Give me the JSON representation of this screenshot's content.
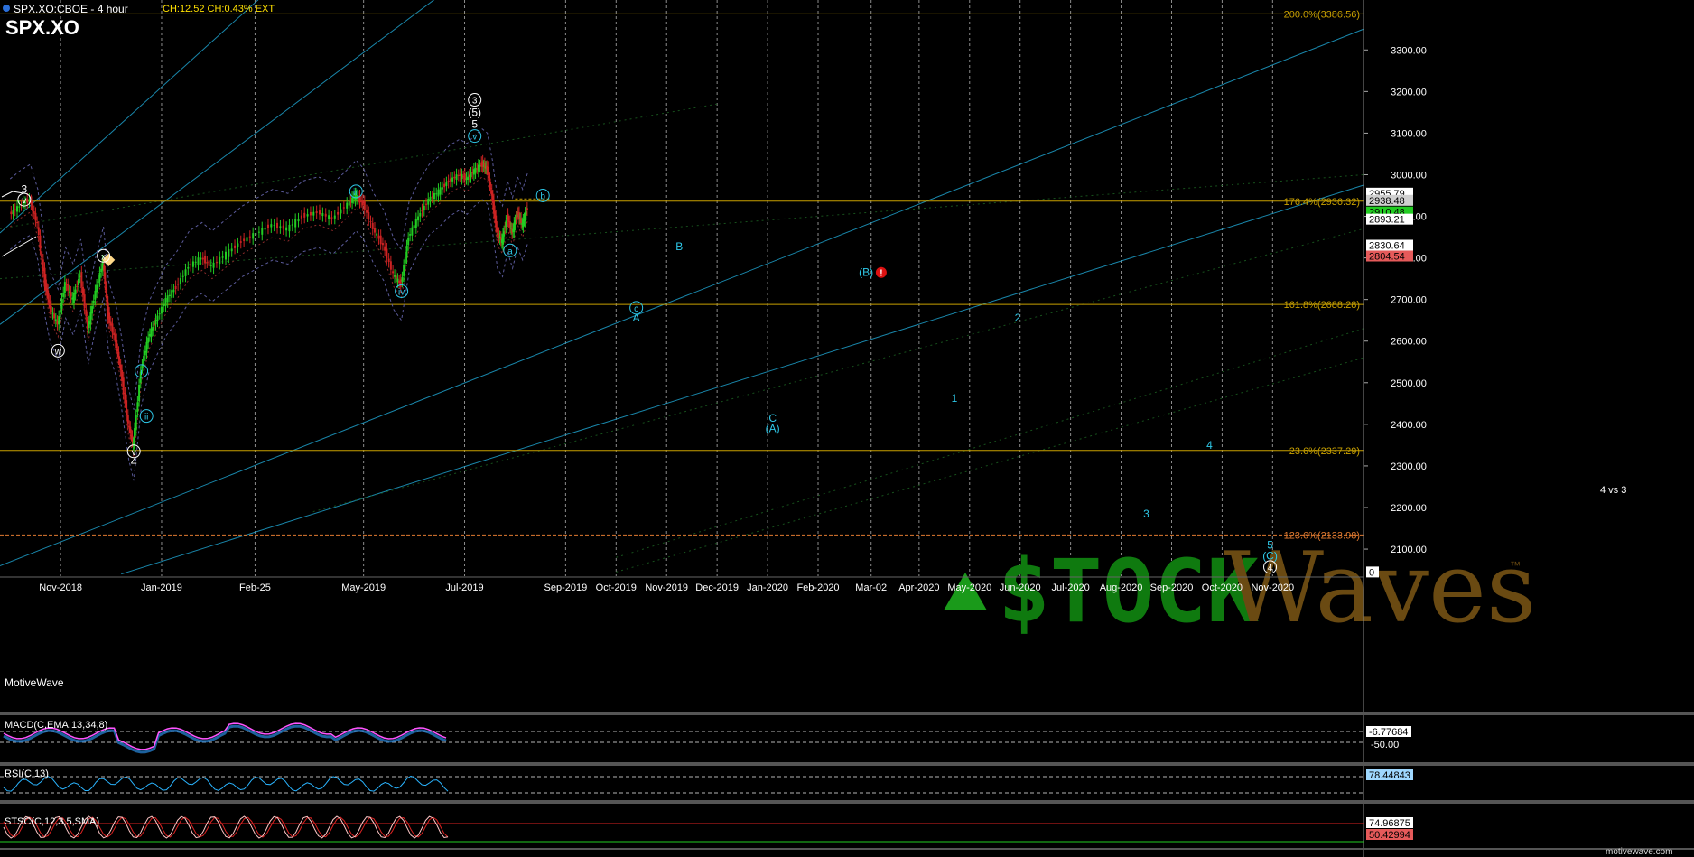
{
  "header": {
    "symbol_line": "SPX.XO:CBOE - 4 hour",
    "stats": "CH:12.52 CH:0.43% EXT",
    "big_symbol": "SPX.XO",
    "watermark": "MotiveWave",
    "footer_brand": "motivewave.com"
  },
  "colors": {
    "background": "#000000",
    "grid": "#ffffff",
    "fib": "#c8a000",
    "fib_extension": "#e07a30",
    "channel": "#1e9ec8",
    "wave_labels": "#2ec8e8",
    "up_candle": "#22cc22",
    "down_candle": "#cc2222",
    "macd_line": "#ff55ff",
    "rsi_line": "#2ab4ff",
    "logo_green": "#1a9a1a",
    "logo_brown": "#8a5a1a"
  },
  "chart_data": {
    "type": "line",
    "title": "SPX.XO",
    "ylim": [
      2035,
      3420
    ],
    "y_ticks": [
      2100,
      2200,
      2300,
      2400,
      2500,
      2600,
      2700,
      2800,
      2900,
      3000,
      3100,
      3200,
      3300
    ],
    "y_tick_labels": [
      "2100.00",
      "2200.00",
      "2300.00",
      "2400.00",
      "2500.00",
      "2600.00",
      "2700.00",
      "2800.00",
      "2900.00",
      "3000.00",
      "3100.00",
      "3200.00",
      "3300.00"
    ],
    "x_labels": [
      "Nov-2018",
      "Jan-2019",
      "Feb-25",
      "May-2019",
      "Jul-2019",
      "Sep-2019",
      "Oct-2019",
      "Nov-2019",
      "Dec-2019",
      "Jan-2020",
      "Feb-2020",
      "Mar-02",
      "Apr-2020",
      "May-2020",
      "Jun-2020",
      "Jul-2020",
      "Aug-2020",
      "Sep-2020",
      "Oct-2020",
      "Nov-2020"
    ],
    "x_label_months": [
      1.0,
      3.0,
      4.85,
      7.0,
      9.0,
      11.0,
      12.0,
      13.0,
      14.0,
      15.0,
      16.0,
      17.05,
      18.0,
      19.0,
      20.0,
      21.0,
      22.0,
      23.0,
      24.0,
      25.0
    ],
    "price_path": [
      [
        0.0,
        2905
      ],
      [
        0.2,
        2925
      ],
      [
        0.4,
        2940
      ],
      [
        0.55,
        2880
      ],
      [
        0.7,
        2740
      ],
      [
        0.8,
        2680
      ],
      [
        0.95,
        2640
      ],
      [
        1.1,
        2740
      ],
      [
        1.25,
        2700
      ],
      [
        1.4,
        2760
      ],
      [
        1.55,
        2630
      ],
      [
        1.7,
        2720
      ],
      [
        1.85,
        2790
      ],
      [
        1.95,
        2660
      ],
      [
        2.1,
        2600
      ],
      [
        2.2,
        2530
      ],
      [
        2.35,
        2400
      ],
      [
        2.45,
        2350
      ],
      [
        2.6,
        2530
      ],
      [
        2.75,
        2610
      ],
      [
        2.9,
        2650
      ],
      [
        3.1,
        2700
      ],
      [
        3.3,
        2730
      ],
      [
        3.55,
        2780
      ],
      [
        3.8,
        2800
      ],
      [
        4.0,
        2780
      ],
      [
        4.3,
        2810
      ],
      [
        4.6,
        2840
      ],
      [
        4.9,
        2860
      ],
      [
        5.2,
        2880
      ],
      [
        5.5,
        2870
      ],
      [
        5.8,
        2900
      ],
      [
        6.1,
        2910
      ],
      [
        6.4,
        2895
      ],
      [
        6.7,
        2930
      ],
      [
        6.85,
        2950
      ],
      [
        7.0,
        2930
      ],
      [
        7.2,
        2870
      ],
      [
        7.4,
        2830
      ],
      [
        7.6,
        2760
      ],
      [
        7.75,
        2735
      ],
      [
        7.9,
        2850
      ],
      [
        8.1,
        2900
      ],
      [
        8.3,
        2940
      ],
      [
        8.5,
        2960
      ],
      [
        8.7,
        2985
      ],
      [
        8.9,
        3000
      ],
      [
        9.05,
        2990
      ],
      [
        9.2,
        3010
      ],
      [
        9.35,
        3025
      ],
      [
        9.45,
        3015
      ],
      [
        9.55,
        2950
      ],
      [
        9.65,
        2860
      ],
      [
        9.75,
        2840
      ],
      [
        9.85,
        2900
      ],
      [
        9.95,
        2860
      ],
      [
        10.05,
        2910
      ],
      [
        10.15,
        2880
      ],
      [
        10.25,
        2920
      ]
    ],
    "levels": [
      {
        "label": "200.0%(3386.56)",
        "value": 3386.56,
        "style": "fib"
      },
      {
        "label": "176.4%(2936.32)",
        "value": 2936.32,
        "style": "fib"
      },
      {
        "label": "161.8%(2688.28)",
        "value": 2688.28,
        "style": "fib"
      },
      {
        "label": "23.6%(2337.29)",
        "value": 2337.29,
        "style": "fib"
      },
      {
        "label": "123.6%(2133.98)",
        "value": 2133.98,
        "style": "ext"
      }
    ],
    "price_tags": [
      {
        "label": "2955.79",
        "value": 2955.79,
        "bg": "#ffffff",
        "fg": "#000000"
      },
      {
        "label": "2938.48",
        "value": 2938.48,
        "bg": "#cfcfcf",
        "fg": "#000000"
      },
      {
        "label": "2910.48",
        "value": 2910.48,
        "bg": "#22cc22",
        "fg": "#000000"
      },
      {
        "label": "2893.21",
        "value": 2893.21,
        "bg": "#ffffff",
        "fg": "#000000"
      },
      {
        "label": "2830.64",
        "value": 2830.64,
        "bg": "#ffffff",
        "fg": "#000000"
      },
      {
        "label": "2804.54",
        "value": 2804.54,
        "bg": "#e55a5a",
        "fg": "#000000"
      },
      {
        "label": "0",
        "value": 2045,
        "bg": "#ffffff",
        "fg": "#000000"
      }
    ],
    "wave_labels": [
      {
        "text": "3",
        "m": 0.28,
        "v": 2965,
        "color": "#ffffff"
      },
      {
        "text": "v",
        "m": 0.28,
        "v": 2940,
        "color": "#ffffff",
        "circle": true
      },
      {
        "text": "x",
        "m": 1.85,
        "v": 2805,
        "color": "#ffffff",
        "circle": true
      },
      {
        "text": "w",
        "m": 0.95,
        "v": 2577,
        "color": "#ffffff",
        "circle": true
      },
      {
        "text": "i",
        "m": 2.6,
        "v": 2528,
        "color": "#2ec8e8",
        "circle": true
      },
      {
        "text": "ii",
        "m": 2.7,
        "v": 2420,
        "color": "#2ec8e8",
        "circle": true
      },
      {
        "text": "v",
        "m": 2.45,
        "v": 2335,
        "color": "#ffffff",
        "circle": true
      },
      {
        "text": "4",
        "m": 2.45,
        "v": 2310,
        "color": "#ffffff"
      },
      {
        "text": "iii",
        "m": 6.85,
        "v": 2960,
        "color": "#2ec8e8",
        "circle": true
      },
      {
        "text": "iv",
        "m": 7.75,
        "v": 2720,
        "color": "#2ec8e8",
        "circle": true
      },
      {
        "text": "3",
        "m": 9.2,
        "v": 3180,
        "color": "#ffffff",
        "circle": true
      },
      {
        "text": "(5)",
        "m": 9.2,
        "v": 3150,
        "color": "#ffffff"
      },
      {
        "text": "5",
        "m": 9.2,
        "v": 3122,
        "color": "#ffffff"
      },
      {
        "text": "v",
        "m": 9.2,
        "v": 3093,
        "color": "#2ec8e8",
        "circle": true
      },
      {
        "text": "a",
        "m": 9.9,
        "v": 2818,
        "color": "#2ec8e8",
        "circle": true
      },
      {
        "text": "b",
        "m": 10.55,
        "v": 2950,
        "color": "#2ec8e8",
        "circle": true
      },
      {
        "text": "B",
        "m": 13.25,
        "v": 2827,
        "color": "#2ec8e8"
      },
      {
        "text": "c",
        "m": 12.4,
        "v": 2680,
        "color": "#2ec8e8",
        "circle": true
      },
      {
        "text": "A",
        "m": 12.4,
        "v": 2656,
        "color": "#2ec8e8"
      },
      {
        "text": "(B)",
        "m": 16.95,
        "v": 2765,
        "color": "#2ec8e8"
      },
      {
        "text": "C",
        "m": 15.1,
        "v": 2415,
        "color": "#2ec8e8"
      },
      {
        "text": "(A)",
        "m": 15.1,
        "v": 2390,
        "color": "#2ec8e8"
      },
      {
        "text": "1",
        "m": 18.7,
        "v": 2463,
        "color": "#2ec8e8"
      },
      {
        "text": "2",
        "m": 19.95,
        "v": 2656,
        "color": "#2ec8e8"
      },
      {
        "text": "3",
        "m": 22.5,
        "v": 2185,
        "color": "#2ec8e8"
      },
      {
        "text": "4",
        "m": 23.75,
        "v": 2350,
        "color": "#2ec8e8"
      },
      {
        "text": "5",
        "m": 24.95,
        "v": 2110,
        "color": "#2ec8e8"
      },
      {
        "text": "(C)",
        "m": 24.95,
        "v": 2084,
        "color": "#2ec8e8"
      },
      {
        "text": "4",
        "m": 24.95,
        "v": 2057,
        "color": "#ffffff",
        "circle": true
      }
    ],
    "note": "4 vs 3",
    "indicators": {
      "macd": {
        "label": "MACD(C,EMA,13,34,8)",
        "value_tag": "-6.77684",
        "tick": "-50.00"
      },
      "rsi": {
        "label": "RSI(C,13)",
        "value_tag": "78.44843"
      },
      "stochastic": {
        "label": "STSC(C,12,3,5,SMA)",
        "value_tag_1": "74.96875",
        "value_tag_2": "50.42994"
      }
    }
  },
  "logo": {
    "part1": "$TOCK",
    "part2": "Waves",
    "tm": "™"
  }
}
